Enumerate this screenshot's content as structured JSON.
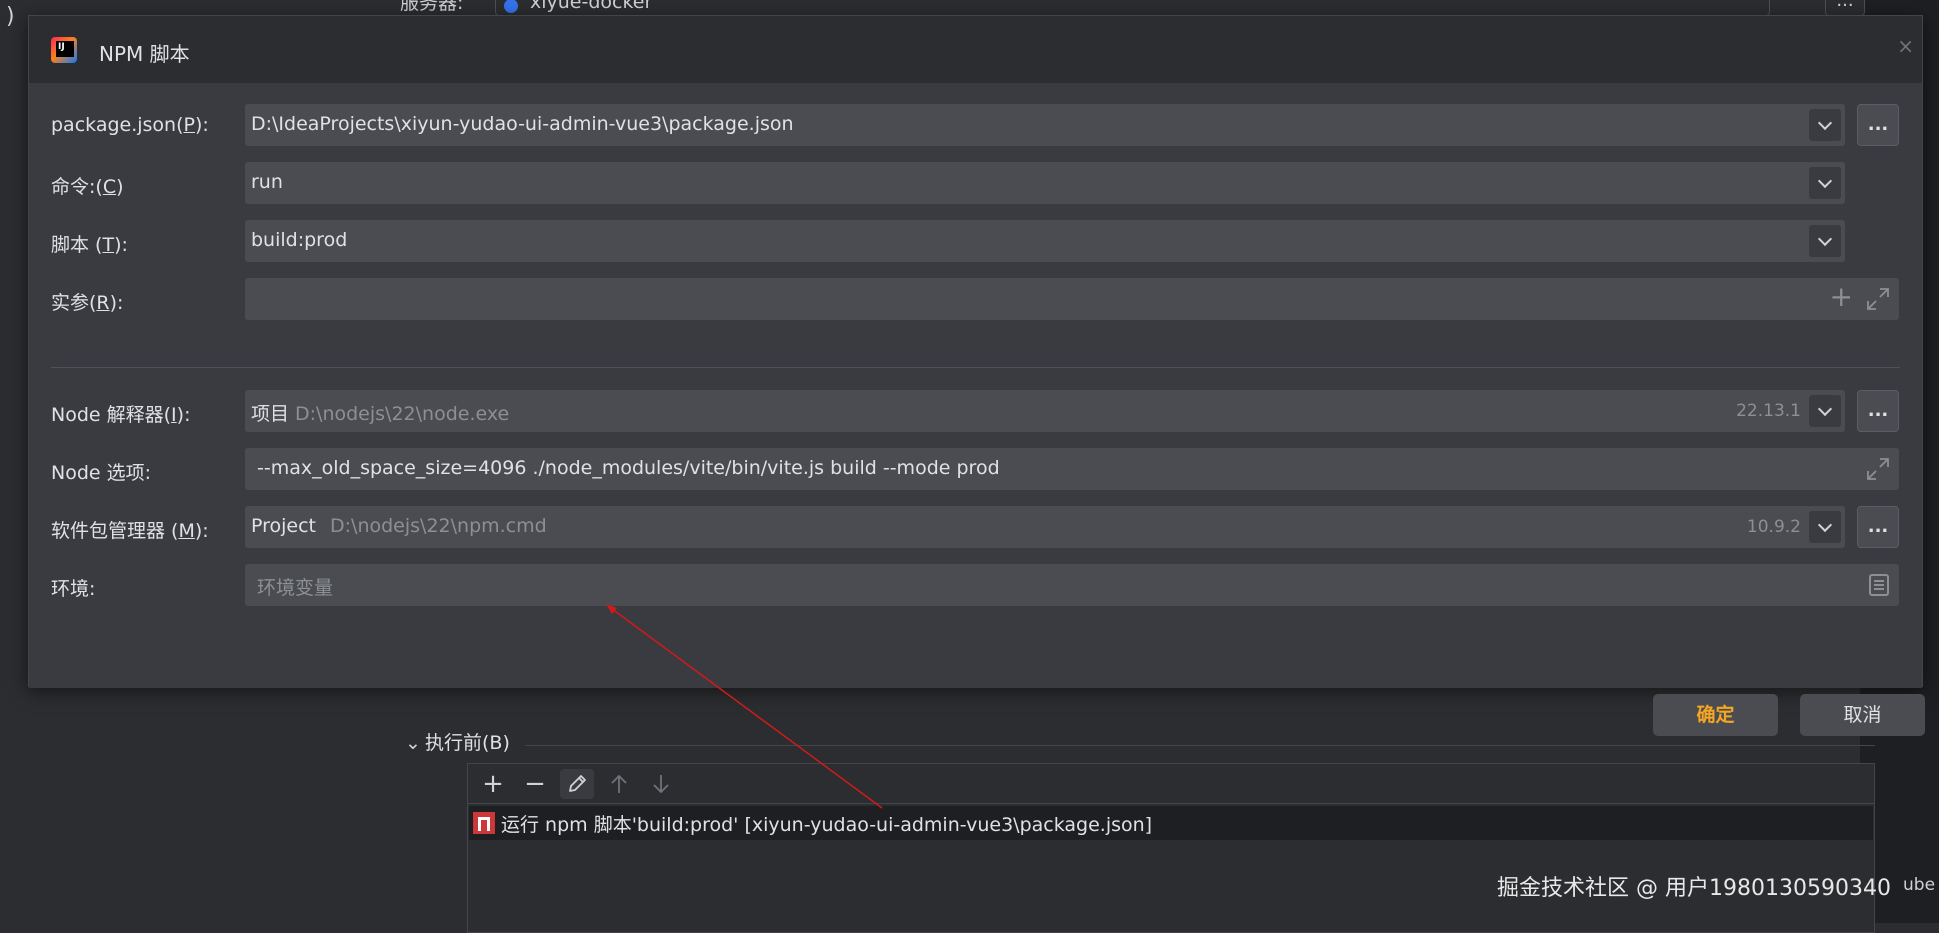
{
  "background": {
    "left_fragment": ")",
    "top_label": "服务器:",
    "top_combo_value": "xiyue-docker",
    "top_browse_label": "...",
    "before_launch": {
      "header": "执行前(B)",
      "toolbar": [
        "add-icon",
        "remove-icon",
        "edit-icon",
        "move-up-icon",
        "move-down-icon"
      ],
      "task": "运行 npm 脚本'build:prod' [xiyun-yudao-ui-admin-vue3\\package.json]"
    },
    "watermark": "掘金技术社区 @ 用户1980130590340",
    "edge_text": "ube"
  },
  "dialog": {
    "title": "NPM 脚本",
    "close_label": "×",
    "fields": {
      "package_json": {
        "label_prefix": "package.json(",
        "label_mnemonic": "P",
        "label_suffix": "):",
        "value": "D:\\IdeaProjects\\xiyun-yudao-ui-admin-vue3\\package.json"
      },
      "command": {
        "label_prefix": "命令:(",
        "label_mnemonic": "C",
        "label_suffix": ")",
        "value": "run"
      },
      "script": {
        "label_prefix": "脚本 (",
        "label_mnemonic": "T",
        "label_suffix": "):",
        "value": "build:prod"
      },
      "arguments": {
        "label_prefix": "实参(",
        "label_mnemonic": "R",
        "label_suffix": "):",
        "value": ""
      },
      "node_interpreter": {
        "label_prefix": "Node 解释器(",
        "label_mnemonic": "I",
        "label_suffix": "):",
        "value": "项目",
        "path": "D:\\nodejs\\22\\node.exe",
        "version": "22.13.1"
      },
      "node_options": {
        "label": "Node 选项:",
        "value": "--max_old_space_size=4096 ./node_modules/vite/bin/vite.js build --mode prod"
      },
      "package_manager": {
        "label_prefix": "软件包管理器 (",
        "label_mnemonic": "M",
        "label_suffix": "):",
        "value": "Project",
        "path": "D:\\nodejs\\22\\npm.cmd",
        "version": "10.9.2"
      },
      "environment": {
        "label": "环境:",
        "placeholder": "环境变量"
      }
    },
    "browse_label": "...",
    "buttons": {
      "ok": "确定",
      "cancel": "取消"
    },
    "colors": {
      "ok_text": "#f5a623",
      "annotation_arrow": "#d11a1a"
    }
  }
}
